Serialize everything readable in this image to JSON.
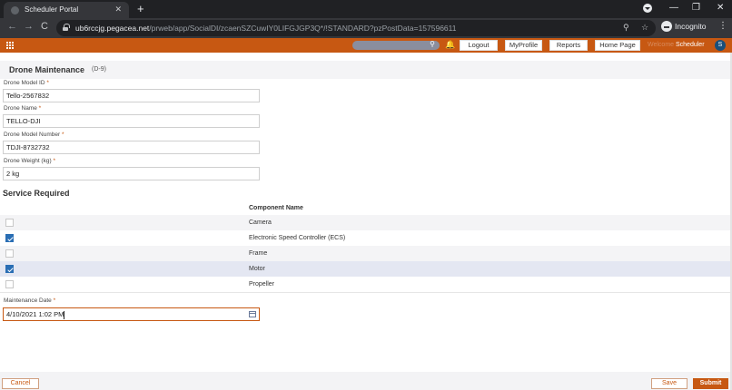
{
  "browser": {
    "tab_title": "Scheduler Portal",
    "tab_close": "✕",
    "new_tab": "+",
    "win_min": "—",
    "win_restore": "❐",
    "win_close": "✕",
    "back": "←",
    "forward": "→",
    "reload": "C",
    "url_host": "ub6rccjg.pegacea.net",
    "url_path": "/prweb/app/SocialDI/zcaenSZCuwIY0LIFGJGP3Q*/!STANDARD?pzPostData=157596611",
    "zoom_icon": "⚲",
    "star_icon": "☆",
    "incognito_label": "Incognito",
    "menu": "⋮"
  },
  "header": {
    "search_icon": "⚲",
    "bell_icon": "🔔",
    "buttons": {
      "logout": "Logout",
      "profile": "MyProfile",
      "reports": "Reports",
      "home": "Home Page"
    },
    "welcome": "Welcome",
    "user": "Scheduler",
    "avatar": "S"
  },
  "form": {
    "title": "Drone Maintenance",
    "case_id": "(D-9)",
    "required_mark": "*",
    "fields": {
      "model_id": {
        "label": "Drone Model ID",
        "value": "Tello-2567832"
      },
      "name": {
        "label": "Drone Name",
        "value": "TELLO-DJI"
      },
      "model_number": {
        "label": "Drone Model Number",
        "value": "TDJI-8732732"
      },
      "weight": {
        "label": "Drone Weight (kg)",
        "value": "2 kg"
      }
    },
    "service_title": "Service Required",
    "table": {
      "column": "Component Name",
      "rows": [
        {
          "name": "Camera",
          "checked": false
        },
        {
          "name": "Electronic Speed Controller (ECS)",
          "checked": true
        },
        {
          "name": "Frame",
          "checked": false
        },
        {
          "name": "Motor",
          "checked": true
        },
        {
          "name": "Propeller",
          "checked": false
        }
      ]
    },
    "maintenance_date": {
      "label": "Maintenance Date",
      "value": "4/10/2021 1:02 PM"
    }
  },
  "footer": {
    "cancel": "Cancel",
    "save": "Save",
    "submit": "Submit"
  },
  "colors": {
    "brand": "#c75812",
    "checkbox": "#2a6eb4"
  }
}
